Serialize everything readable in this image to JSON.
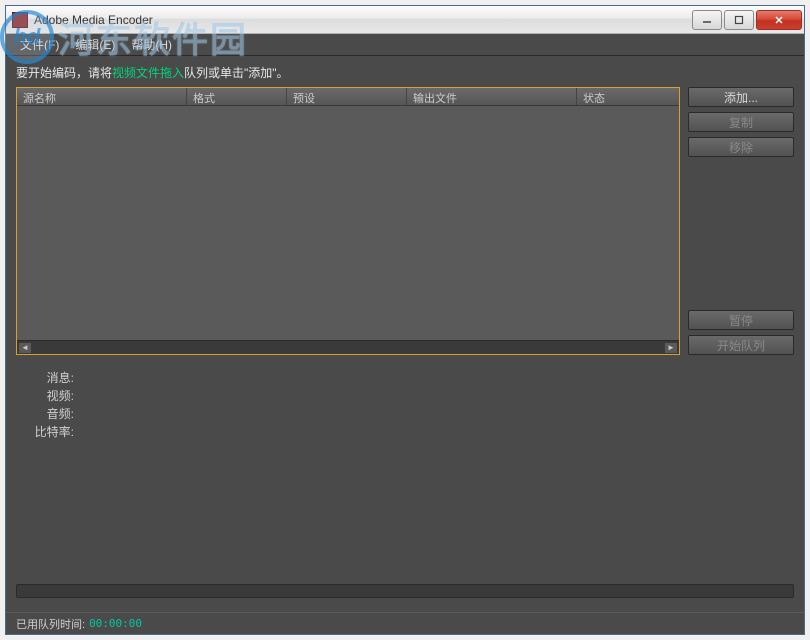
{
  "window": {
    "title": "Adobe Media Encoder"
  },
  "menubar": {
    "file": "文件(F)",
    "edit": "编辑(E)",
    "help": "帮助(H)"
  },
  "hint": {
    "prefix": "要开始编码，请将",
    "accent": "视频文件拖入",
    "suffix": "队列或单击\"添加\"。"
  },
  "queue": {
    "columns": {
      "source": "源名称",
      "format": "格式",
      "preset": "预设",
      "output": "输出文件",
      "status": "状态"
    }
  },
  "buttons": {
    "add": "添加...",
    "duplicate": "复制",
    "remove": "移除",
    "pause": "暂停",
    "start": "开始队列"
  },
  "info": {
    "message_label": "消息:",
    "video_label": "视频:",
    "audio_label": "音频:",
    "bitrate_label": "比特率:"
  },
  "status": {
    "elapsed_label": "已用队列时间:",
    "elapsed_value": "00:00:00"
  },
  "watermark": {
    "logo": "hd",
    "text": "河东软件园"
  }
}
